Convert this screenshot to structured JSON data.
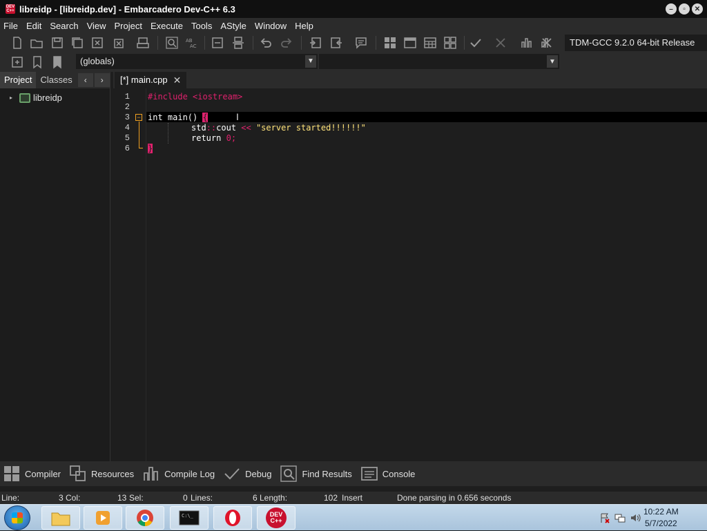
{
  "window": {
    "title": "libreidp - [libreidp.dev] - Embarcadero Dev-C++ 6.3",
    "app_icon_text": "DEV C++"
  },
  "menu": [
    "File",
    "Edit",
    "Search",
    "View",
    "Project",
    "Execute",
    "Tools",
    "AStyle",
    "Window",
    "Help"
  ],
  "toolbar": {
    "compiler": "TDM-GCC 9.2.0 64-bit Release",
    "scope": "(globals)",
    "function": ""
  },
  "left_panel": {
    "tabs": [
      "Project",
      "Classes"
    ],
    "active_tab": "Project",
    "tree_root": "libreidp"
  },
  "editor": {
    "tab_label": "[*] main.cpp",
    "line_numbers": [
      "1",
      "2",
      "3",
      "4",
      "5",
      "6"
    ],
    "code": {
      "l1_directive": "#include <iostream>",
      "l3_type": "int",
      "l3_func": " main() ",
      "l3_brace": "{",
      "l4_std": "std",
      "l4_scope": "::",
      "l4_cout": "cout ",
      "l4_op": "<<",
      "l4_str": " \"server started!!!!!!\"",
      "l5_return": "return ",
      "l5_zero": "0",
      "l5_semi": ";",
      "l6_brace": "}"
    }
  },
  "bottom_tabs": [
    "Compiler",
    "Resources",
    "Compile Log",
    "Debug",
    "Find Results",
    "Console"
  ],
  "status": {
    "line_label": "Line:",
    "line_value": "3",
    "col_label": "Col:",
    "col_value": "13",
    "sel_label": "Sel:",
    "sel_value": "0",
    "lines_label": "Lines:",
    "lines_value": "6",
    "length_label": "Length:",
    "length_value": "102",
    "mode": "Insert",
    "message": "Done parsing in 0.656 seconds"
  },
  "taskbar": {
    "dev_icon_text": "DEV C++",
    "time": "10:22 AM",
    "date": "5/7/2022"
  },
  "colors": {
    "accent": "#e0216d",
    "string": "#ffe37a",
    "fold": "#f0a020"
  }
}
